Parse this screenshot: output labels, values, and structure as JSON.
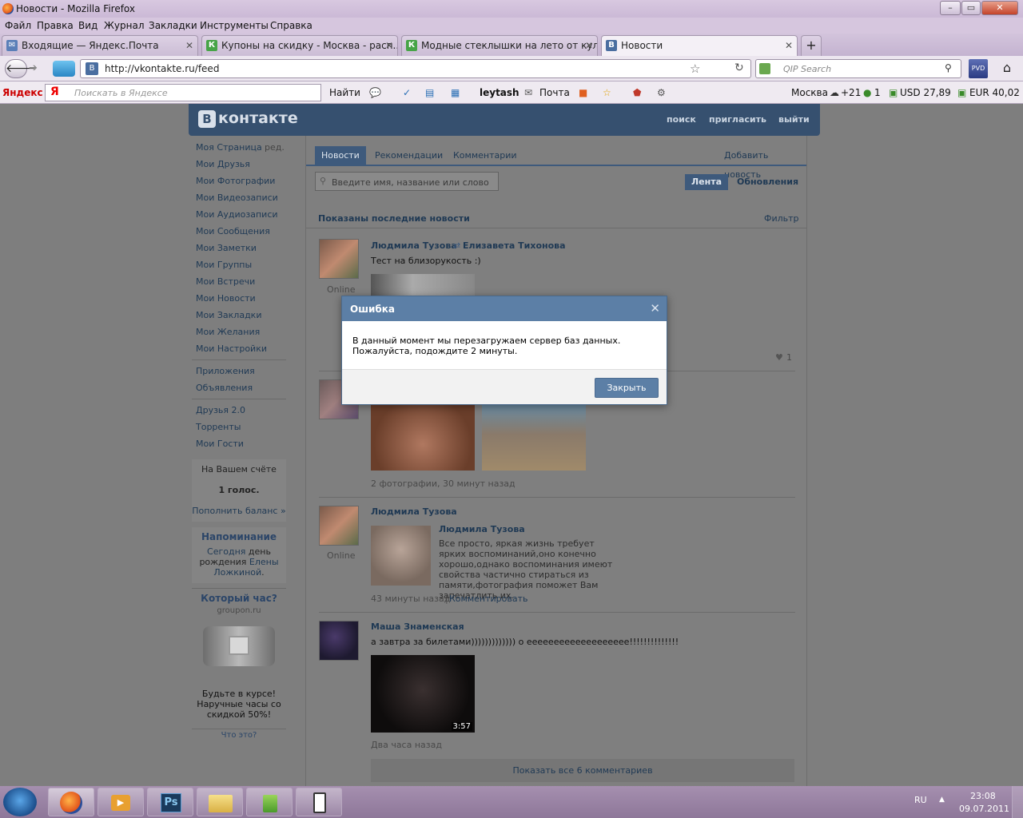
{
  "window": {
    "title": "Новости - Mozilla Firefox"
  },
  "menu": [
    "Файл",
    "Правка",
    "Вид",
    "Журнал",
    "Закладки",
    "Инструменты",
    "Справка"
  ],
  "tabs": [
    {
      "label": "Входящие — Яндекс.Почта",
      "icon": "mail-icon",
      "color": "#5a7fb8"
    },
    {
      "label": "Купоны на скидку - Москва - расп...",
      "icon": "coupon-icon",
      "color": "#47a447"
    },
    {
      "label": "Модные стеклышки на лето от кул...",
      "icon": "coupon-icon",
      "color": "#47a447"
    },
    {
      "label": "Новости",
      "icon": "vk-icon",
      "color": "#4a6ea0"
    }
  ],
  "nav": {
    "url": "http://vkontakte.ru/feed",
    "qip_placeholder": "QIP Search"
  },
  "yandex": {
    "logo": "Яндекс",
    "search_placeholder": "Поискать в Яндексе",
    "find": "Найти",
    "user": "leytash",
    "mail": "Почта",
    "city": "Москва",
    "temp": "+21",
    "traffic": "1",
    "usd": "USD 27,89",
    "eur": "EUR 40,02"
  },
  "vk": {
    "logo": "контакте",
    "logo_letter": "В",
    "header_links": [
      "поиск",
      "пригласить",
      "выйти"
    ],
    "menu_edit": "ред.",
    "menu": [
      "Моя Страница",
      "Мои Друзья",
      "Мои Фотографии",
      "Мои Видеозаписи",
      "Мои Аудиозаписи",
      "Мои Сообщения",
      "Мои Заметки",
      "Мои Группы",
      "Мои Встречи",
      "Мои Новости",
      "Мои Закладки",
      "Мои Желания",
      "Мои Настройки"
    ],
    "menu2": [
      "Приложения",
      "Объявления"
    ],
    "menu3": [
      "Друзья 2.0",
      "Торренты",
      "Мои Гости"
    ],
    "balance": {
      "line1": "На Вашем счёте",
      "line2": "1 голос.",
      "link": "Пополнить баланс »"
    },
    "reminder": {
      "title": "Напоминание",
      "t1": "Сегодня",
      "t2": " день",
      "t3": "рождения ",
      "t4": "Елены",
      "t5": "Ложкиной",
      "t6": "."
    },
    "ad": {
      "title": "Который час?",
      "domain": "groupon.ru",
      "text": "Будьте в курсе! Наручные часы со скидкой 50%!",
      "what": "Что это?"
    },
    "tabs": [
      "Новости",
      "Рекомендации",
      "Комментарии"
    ],
    "add_news": "Добавить новость",
    "search_placeholder": "Введите имя, название или слово",
    "btn_feed": "Лента",
    "btn_updates": "Обновления",
    "shown": "Показаны последние новости",
    "filter": "Фильтр",
    "posts": [
      {
        "author": "Людмила Тузова",
        "repost_to": "Елизавета Тихонова",
        "text": "Тест на близорукость :)",
        "online": "Online",
        "likes": "1"
      },
      {
        "meta": "2 фотографии, 30 минут назад"
      },
      {
        "author": "Людмила Тузова",
        "online": "Online",
        "note_author": "Людмила Тузова",
        "note_text": "Все просто, яркая жизнь требует ярких воспоминаний,оно конечно хорошо,однако воспоминания имеют свойства частично стираться из памяти,фотография поможет Вам запечатлить их.",
        "meta": "43 минуты назад",
        "comment": "Комментировать"
      },
      {
        "author": "Маша Знаменская",
        "text": "а завтра за билетами))))))))))))) о еееееееееееееееееее!!!!!!!!!!!!!!",
        "video_time": "3:57",
        "meta": "Два часа назад",
        "show_comments": "Показать все 6 комментариев"
      }
    ]
  },
  "modal": {
    "title": "Ошибка",
    "body": "В данный момент мы перезагружаем сервер баз данных. Пожалуйста, подождите 2 минуты.",
    "close": "Закрыть"
  },
  "taskbar": {
    "lang": "RU",
    "time": "23:08",
    "date": "09.07.2011"
  }
}
